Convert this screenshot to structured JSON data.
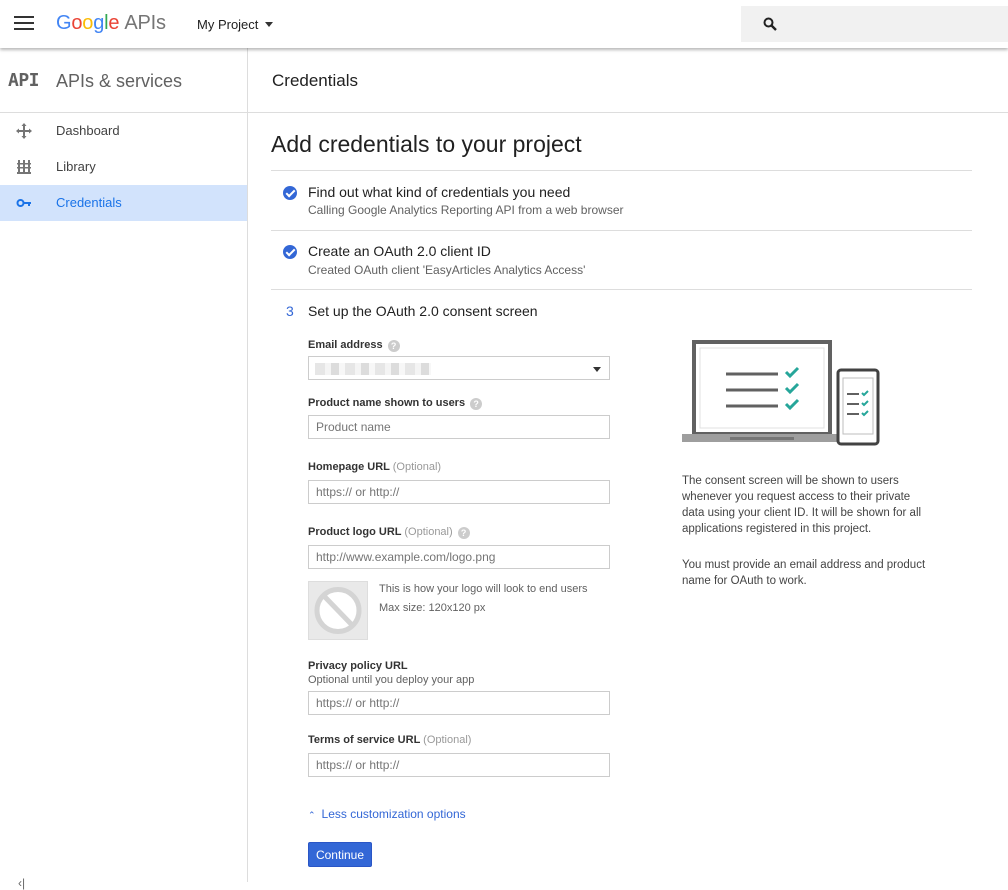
{
  "header": {
    "logo_letters": [
      "G",
      "o",
      "o",
      "g",
      "l",
      "e"
    ],
    "logo_suffix": "APIs",
    "project": "My Project"
  },
  "sidebar": {
    "badge": "API",
    "title": "APIs & services",
    "items": [
      {
        "label": "Dashboard",
        "icon": "dashboard-icon",
        "active": false
      },
      {
        "label": "Library",
        "icon": "library-icon",
        "active": false
      },
      {
        "label": "Credentials",
        "icon": "key-icon",
        "active": true
      }
    ]
  },
  "page": {
    "title": "Credentials",
    "heading": "Add credentials to your project"
  },
  "steps": [
    {
      "title": "Find out what kind of credentials you need",
      "subtitle": "Calling Google Analytics Reporting API from a web browser",
      "done": true
    },
    {
      "title": "Create an OAuth 2.0 client ID",
      "subtitle": "Created OAuth client 'EasyArticles Analytics Access'",
      "done": true
    },
    {
      "number": "3",
      "title": "Set up the OAuth 2.0 consent screen",
      "done": false
    }
  ],
  "form": {
    "email_label": "Email address",
    "product_label": "Product name shown to users",
    "product_placeholder": "Product name",
    "homepage_label": "Homepage URL",
    "homepage_optional": "(Optional)",
    "homepage_placeholder": "https:// or http://",
    "logo_label": "Product logo URL",
    "logo_optional": "(Optional)",
    "logo_placeholder": "http://www.example.com/logo.png",
    "logo_note_1": "This is how your logo will look to end users",
    "logo_note_2": "Max size: 120x120 px",
    "privacy_label": "Privacy policy URL",
    "privacy_note": "Optional until you deploy your app",
    "privacy_placeholder": "https:// or http://",
    "tos_label": "Terms of service URL",
    "tos_optional": "(Optional)",
    "tos_placeholder": "https:// or http://",
    "less_options": "Less customization options",
    "continue": "Continue"
  },
  "info": {
    "paragraph_1": "The consent screen will be shown to users whenever you request access to their private data using your client ID. It will be shown for all applications registered in this project.",
    "paragraph_2": "You must provide an email address and product name for OAuth to work."
  },
  "colors": {
    "accent": "#3367d6",
    "active_bg": "#d2e3fc",
    "check_teal": "#26a69a"
  }
}
